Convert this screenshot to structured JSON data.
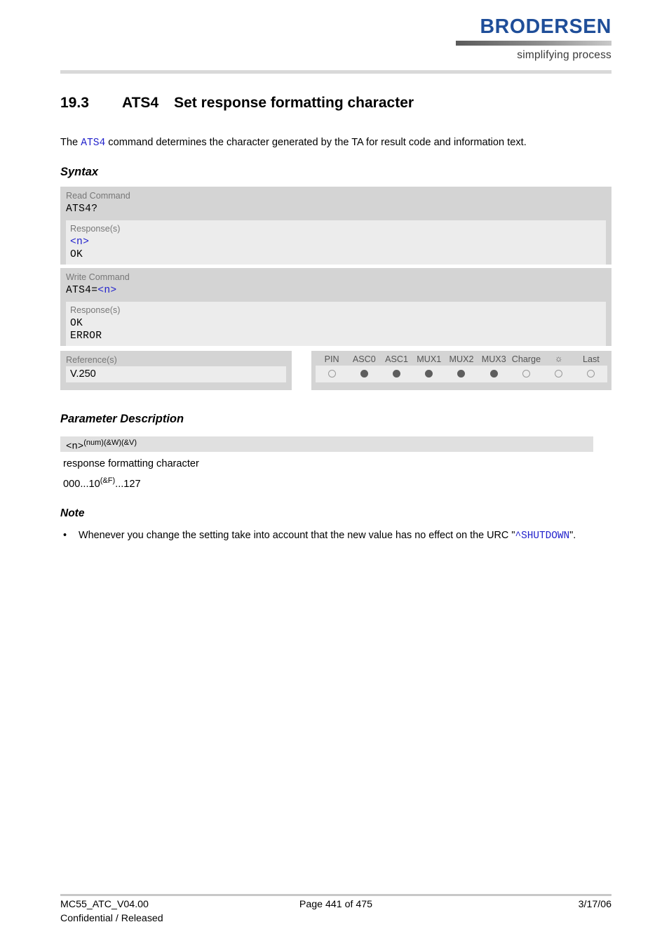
{
  "header": {
    "logo_word": "BRODERSEN",
    "logo_tagline": "simplifying process",
    "logo_color": "#1f4e99"
  },
  "title": {
    "number": "19.3",
    "command": "ATS4",
    "text": "Set response formatting character"
  },
  "intro": {
    "before": "The ",
    "command": "ATS4",
    "after": " command determines the character generated by the TA for result code and information text."
  },
  "sections": {
    "syntax": "Syntax",
    "parameter_description": "Parameter Description",
    "note": "Note"
  },
  "syntax": {
    "read": {
      "label": "Read Command",
      "code": "ATS4?",
      "response_label": "Response(s)",
      "responses": [
        "<n>",
        "OK"
      ]
    },
    "write": {
      "label": "Write Command",
      "code_prefix": "ATS4=",
      "code_param": "<n>",
      "response_label": "Response(s)",
      "responses": [
        "OK",
        "ERROR"
      ]
    }
  },
  "reference": {
    "label": "Reference(s)",
    "value": "V.250"
  },
  "capabilities": {
    "columns": [
      "PIN",
      "ASC0",
      "ASC1",
      "MUX1",
      "MUX2",
      "MUX3",
      "Charge",
      "sun-icon",
      "Last"
    ],
    "states": [
      "hollow",
      "filled",
      "filled",
      "filled",
      "filled",
      "filled",
      "hollow",
      "hollow",
      "hollow"
    ],
    "filled_color": "#5e5e5e",
    "hollow_border_color": "#9a9a9a"
  },
  "parameter": {
    "name": "<n>",
    "superscript": "(num)(&W)(&V)",
    "description": "response formatting character",
    "range_prefix": "000...10",
    "range_superscript": "(&F)",
    "range_suffix": "...127"
  },
  "note": {
    "bullet": "•",
    "text_before": "Whenever you change the setting take into account that the new value has no effect on the URC \"",
    "urc": "^SHUTDOWN",
    "text_after": "\"."
  },
  "footer": {
    "document": "MC55_ATC_V04.00",
    "classification": "Confidential / Released",
    "page": "Page 441 of 475",
    "date": "3/17/06"
  }
}
